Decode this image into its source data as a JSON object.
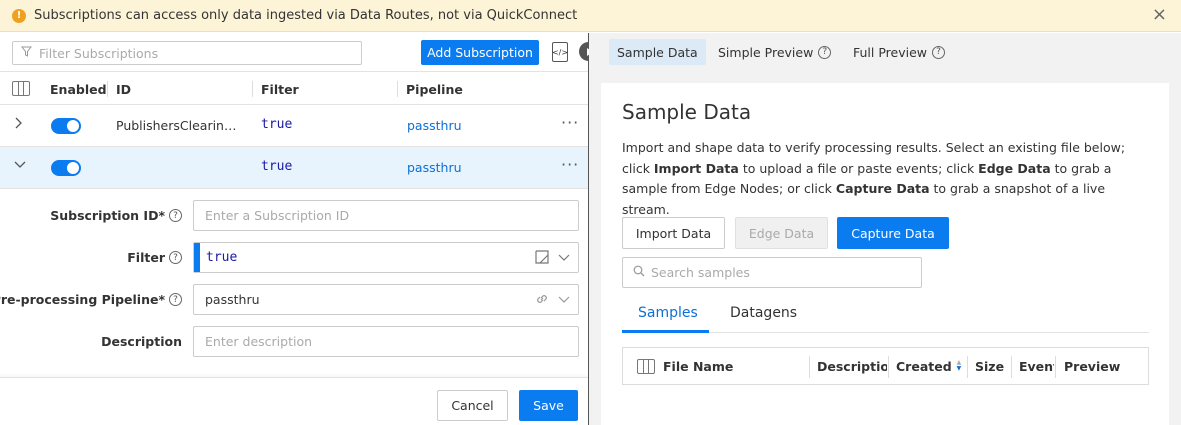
{
  "banner": {
    "icon": "warning-icon",
    "message": "Subscriptions can access only data ingested via Data Routes, not via QuickConnect",
    "close_glyph": "×"
  },
  "left": {
    "filter_placeholder": "Filter Subscriptions",
    "add_button": "Add Subscription",
    "columns": {
      "enabled": "Enabled",
      "id": "ID",
      "filter": "Filter",
      "pipeline": "Pipeline"
    },
    "rows": [
      {
        "id": "PublishersClearin…",
        "filter": "true",
        "pipeline": "passthru",
        "enabled": true,
        "expanded": false
      },
      {
        "id": "",
        "filter": "true",
        "pipeline": "passthru",
        "enabled": true,
        "expanded": true
      }
    ],
    "more_glyph": "···",
    "form": {
      "subscription_id_label": "Subscription ID*",
      "subscription_id_placeholder": "Enter a Subscription ID",
      "filter_label": "Filter",
      "filter_value": "true",
      "pipeline_label": "Pre-processing Pipeline*",
      "pipeline_value": "passthru",
      "description_label": "Description",
      "description_placeholder": "Enter description"
    },
    "cancel_button": "Cancel",
    "save_button": "Save"
  },
  "right": {
    "tabs": [
      {
        "label": "Sample Data",
        "active": true
      },
      {
        "label": "Simple Preview",
        "active": false
      },
      {
        "label": "Full Preview",
        "active": false
      }
    ],
    "title": "Sample Data",
    "description_parts": {
      "p1": "Import and shape data to verify processing results. Select an existing file below; click ",
      "b1": "Import Data",
      "p2": " to upload a file or paste events; click ",
      "b2": "Edge Data",
      "p3": " to grab a sample from Edge Nodes; or click ",
      "b3": "Capture Data",
      "p4": " to grab a snapshot of a live stream."
    },
    "import_button": "Import Data",
    "edge_button": "Edge Data",
    "capture_button": "Capture Data",
    "search_placeholder": "Search samples",
    "sample_tabs": [
      {
        "label": "Samples",
        "active": true
      },
      {
        "label": "Datagens",
        "active": false
      }
    ],
    "table_columns": {
      "file_name": "File Name",
      "description": "Description",
      "created": "Created",
      "size": "Size",
      "events": "Events",
      "preview": "Preview"
    }
  },
  "colors": {
    "accent": "#0b7cef",
    "banner_bg": "#fdf4d7",
    "selected_row": "#e8f4fd",
    "warning": "#f0a020"
  }
}
